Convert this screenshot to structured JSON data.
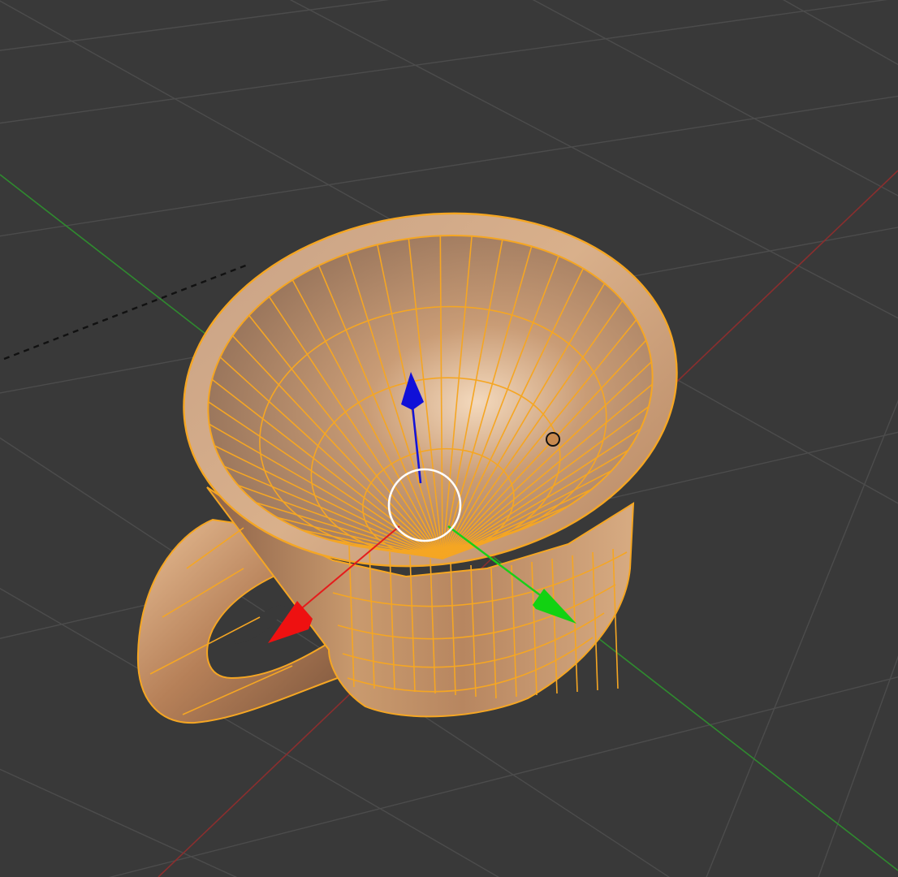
{
  "viewport": {
    "background": "#393939",
    "grid_color": "#4b4b4b",
    "axis_x_color": "#7d2a2a",
    "axis_y_color": "#2d7d2d"
  },
  "object": {
    "name": "cup",
    "state": "selected",
    "mode": "edit-wireframe-overlay",
    "outline_color": "#f5a623",
    "shade_light": "#f3d0ac",
    "shade_mid": "#c28f66",
    "shade_dark": "#8a6448"
  },
  "gizmo": {
    "type": "translate",
    "x_color": "#e51c1c",
    "y_color": "#18d018",
    "z_color": "#1010d8",
    "center_ring_color": "#ffffff"
  },
  "origin_marker": {
    "icon": "object-origin-icon"
  },
  "relationship_line": {
    "style": "dashed",
    "color": "#000000"
  }
}
